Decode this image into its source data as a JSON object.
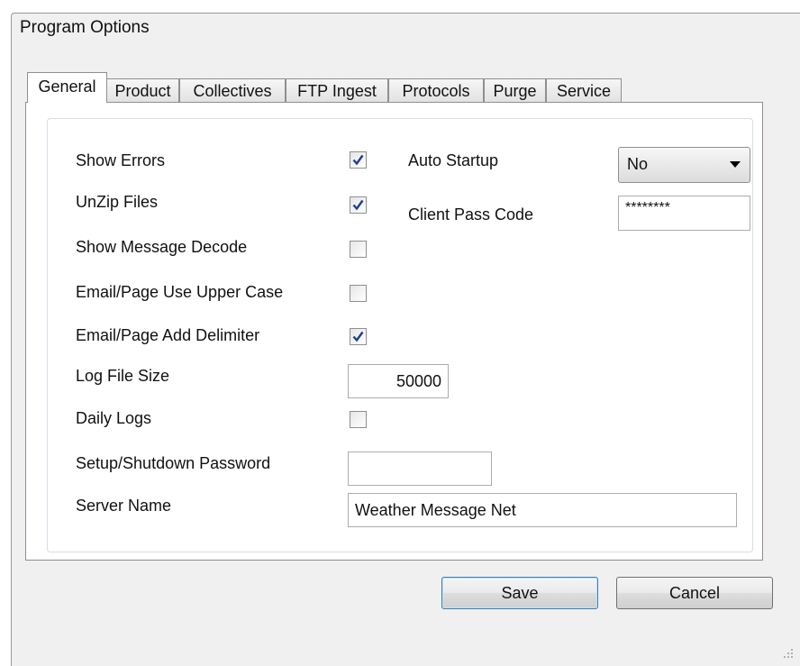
{
  "window": {
    "title": "Program Options"
  },
  "tabs": [
    {
      "label": "General",
      "active": true
    },
    {
      "label": "Product",
      "active": false
    },
    {
      "label": "Collectives",
      "active": false
    },
    {
      "label": "FTP Ingest",
      "active": false
    },
    {
      "label": "Protocols",
      "active": false
    },
    {
      "label": "Purge",
      "active": false
    },
    {
      "label": "Service",
      "active": false
    }
  ],
  "general": {
    "show_errors": {
      "label": "Show Errors",
      "checked": true
    },
    "unzip_files": {
      "label": "UnZip Files",
      "checked": true
    },
    "show_message_decode": {
      "label": "Show Message Decode",
      "checked": false
    },
    "email_upper_case": {
      "label": "Email/Page Use Upper Case",
      "checked": false
    },
    "email_add_delimiter": {
      "label": "Email/Page Add Delimiter",
      "checked": true
    },
    "log_file_size": {
      "label": "Log File Size",
      "value": "50000"
    },
    "daily_logs": {
      "label": "Daily Logs",
      "checked": false
    },
    "setup_password": {
      "label": "Setup/Shutdown Password",
      "value": ""
    },
    "server_name": {
      "label": "Server Name",
      "value": "Weather Message Net"
    },
    "auto_startup": {
      "label": "Auto Startup",
      "value": "No"
    },
    "client_pass_code": {
      "label": "Client Pass Code",
      "value": "********"
    }
  },
  "buttons": {
    "save": "Save",
    "cancel": "Cancel"
  },
  "colors": {
    "checkmark": "#1c3f94",
    "tab_border": "#8e8f8f",
    "default_button_border": "#3c7fb1"
  }
}
